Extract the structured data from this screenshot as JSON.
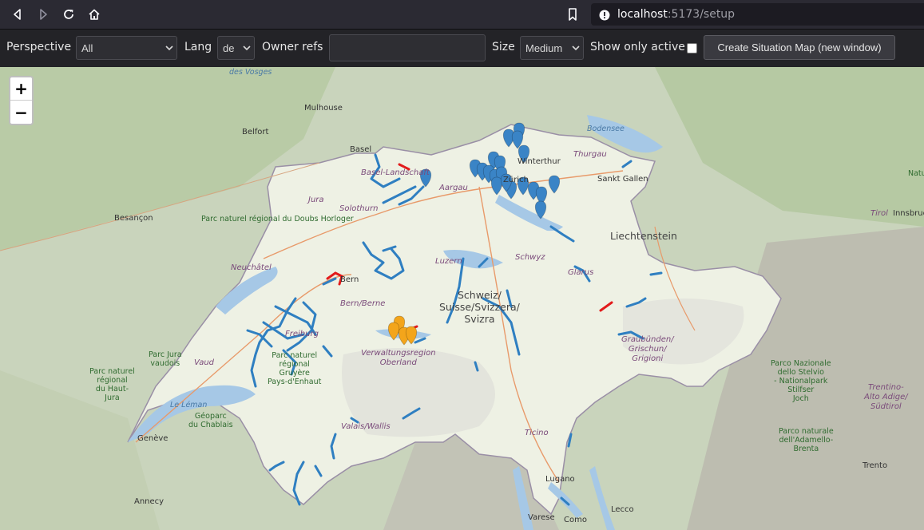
{
  "browser": {
    "url_host": "localhost",
    "url_path": ":5173/setup"
  },
  "toolbar": {
    "perspective_label": "Perspective",
    "perspective_value": "All",
    "lang_label": "Lang",
    "lang_value": "de",
    "owner_refs_label": "Owner refs",
    "owner_refs_value": "",
    "size_label": "Size",
    "size_value": "Medium",
    "show_only_active_label": "Show only active",
    "show_only_active_checked": false,
    "create_button_label": "Create Situation Map (new window)"
  },
  "map": {
    "zoom_in_label": "+",
    "zoom_out_label": "−",
    "country_label": "Schweiz/\nSuisse/Svizzera/\nSvizra",
    "labels": {
      "des_vosges": "des Vosges",
      "mulhouse": "Mulhouse",
      "belfort": "Belfort",
      "basel": "Basel",
      "basel_landschaft": "Basel-Landschaft",
      "aargau": "Aargau",
      "winterthur": "Winterthur",
      "zurich": "Zürich",
      "thurgau": "Thurgau",
      "bodensee": "Bodensee",
      "sankt_gallen": "Sankt Gallen",
      "jura": "Jura",
      "solothurn": "Solothurn",
      "besancon": "Besançon",
      "doubs_park": "Parc naturel\nrégional\ndu Doubs\nHorloger",
      "liechtenstein": "Liechtenstein",
      "tirol": "Tirol",
      "innsbruck": "Innsbruck",
      "natur_karw": "Natu\nKarw",
      "neuchatel": "Neuchâtel",
      "bern": "Bern",
      "bern_berne": "Bern/Berne",
      "luzern": "Luzern",
      "schwyz": "Schwyz",
      "glarus": "Glarus",
      "freiburg": "Freiburg",
      "verwaltungsregion": "Verwaltungsregion\nOberland",
      "graubunden": "Graubünden/\nGrischun/\nGrigioni",
      "stelvio_park": "Parco Nazionale\ndello Stelvio\n- Nationalpark\nStilfser\nJoch",
      "alto_adige": "Trentino-\nAlto Adige/\nSüdtirol",
      "jura_vaudois": "Parc Jura\nvaudois",
      "gruyere_park": "Parc naturel\nrégional\nGruyère\nPays-d'Enhaut",
      "vaud": "Vaud",
      "haut_jura": "Parc naturel\nrégional\ndu Haut-\nJura",
      "le_leman": "Le Léman",
      "geoparc": "Géoparc\ndu Chablais",
      "geneve": "Genève",
      "valais": "Valais/Wallis",
      "ticino": "Ticino",
      "adamello_park": "Parco naturale\ndell'Adamello-\nBrenta",
      "trento": "Trento",
      "lugano": "Lugano",
      "lecco": "Lecco",
      "varese": "Varese",
      "como": "Como",
      "annecy": "Annecy"
    },
    "colors": {
      "marker_blue": "#3a84c6",
      "marker_orange": "#f3a51b",
      "route_blue": "#2f7fc1",
      "route_red": "#e21b1b",
      "swiss_fill": "#eef1e4"
    }
  }
}
